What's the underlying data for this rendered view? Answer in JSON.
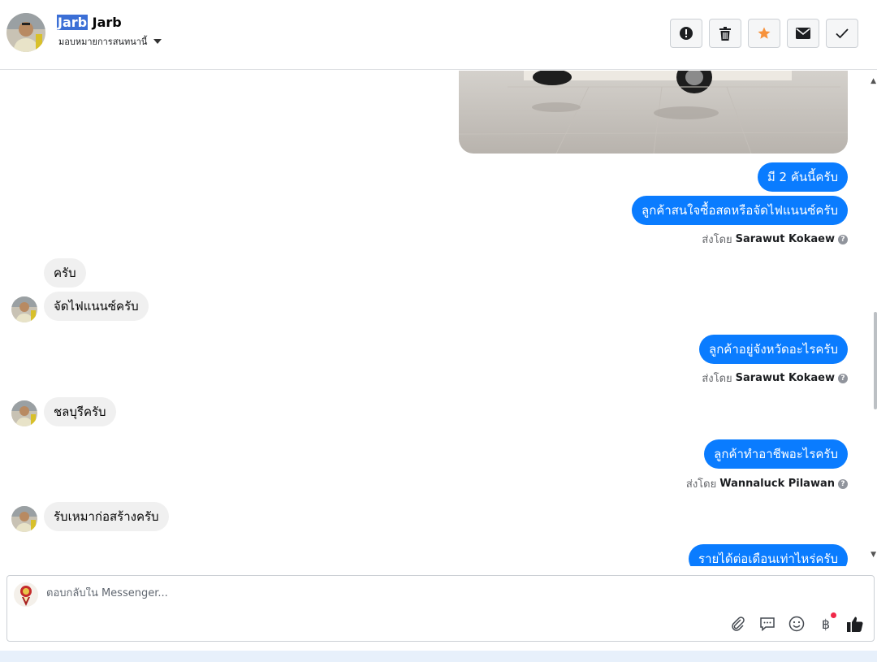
{
  "header": {
    "name_highlight": "Jarb",
    "name_rest": " Jarb",
    "assign_label": "มอบหมายการสนทนานี้",
    "icons": [
      "alert-icon",
      "trash-icon",
      "star-icon",
      "mail-icon",
      "check-icon"
    ],
    "star_color": "#f7923b"
  },
  "messages": [
    {
      "dir": "out",
      "text": "มี 2 คันนี้ครับ"
    },
    {
      "dir": "out",
      "text": "ลูกค้าสนใจซื้อสดหรือจัดไฟแนนซ์ครับ"
    },
    {
      "sent_by_label": "ส่งโดย",
      "sent_by_name": "Sarawut Kokaew"
    },
    {
      "dir": "in",
      "text": "ครับ"
    },
    {
      "dir": "in",
      "text": "จัดไฟแนนซ์ครับ"
    },
    {
      "dir": "out",
      "text": "ลูกค้าอยู่จังหวัดอะไรครับ"
    },
    {
      "sent_by_label": "ส่งโดย",
      "sent_by_name": "Sarawut Kokaew"
    },
    {
      "dir": "in",
      "text": "ชลบุรีครับ"
    },
    {
      "dir": "out",
      "text": "ลูกค้าทำอาชีพอะไรครับ"
    },
    {
      "sent_by_label": "ส่งโดย",
      "sent_by_name": "Wannaluck Pilawan"
    },
    {
      "dir": "in",
      "text": "รับเหมาก่อสร้างครับ"
    },
    {
      "dir": "out",
      "text": "รายได้ต่อเดือนเท่าไหร่ครับ"
    }
  ],
  "composer": {
    "placeholder": "ตอบกลับใน Messenger...",
    "tools": [
      "attach-icon",
      "saved-reply-icon",
      "emoji-icon",
      "baht-icon",
      "like-icon"
    ]
  },
  "colors": {
    "outgoing_bubble": "#0a7cff",
    "incoming_bubble": "#f0f0f0",
    "highlight": "#3b6fd6",
    "notification_dot": "#f02849"
  }
}
